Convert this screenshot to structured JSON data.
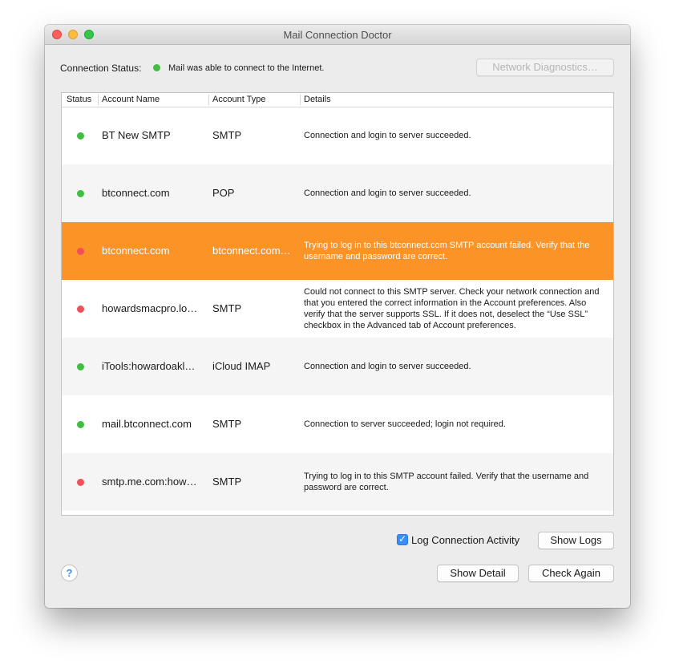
{
  "window": {
    "title": "Mail Connection Doctor"
  },
  "status": {
    "label": "Connection Status:",
    "message": "Mail was able to connect to the Internet.",
    "indicator": "green"
  },
  "buttons": {
    "network_diagnostics": "Network Diagnostics…",
    "show_logs": "Show Logs",
    "show_detail": "Show Detail",
    "check_again": "Check Again",
    "help": "?"
  },
  "log_activity": {
    "label": "Log Connection Activity",
    "checked": true
  },
  "table": {
    "columns": [
      "Status",
      "Account Name",
      "Account Type",
      "Details"
    ],
    "rows": [
      {
        "status": "green",
        "name": "BT New SMTP",
        "type": "SMTP",
        "details": "Connection and login to server succeeded."
      },
      {
        "status": "green",
        "name": "btconnect.com",
        "type": "POP",
        "details": "Connection and login to server succeeded."
      },
      {
        "status": "red",
        "name": "btconnect.com",
        "type": "btconnect.com…",
        "details": "Trying to log in to this btconnect.com SMTP account failed. Verify that the username and password are correct."
      },
      {
        "status": "red",
        "name": "howardsmacpro.lo…",
        "type": "SMTP",
        "details": "Could not connect to this SMTP server. Check your network connection and that you entered the correct information in the Account preferences. Also verify that the server supports SSL. If it does not, deselect the “Use SSL” checkbox in the Advanced tab of Account preferences."
      },
      {
        "status": "green",
        "name": "iTools:howardoakl…",
        "type": "iCloud IMAP",
        "details": "Connection and login to server succeeded."
      },
      {
        "status": "green",
        "name": "mail.btconnect.com",
        "type": "SMTP",
        "details": "Connection to server succeeded; login not required."
      },
      {
        "status": "red",
        "name": "smtp.me.com:how…",
        "type": "SMTP",
        "details": "Trying to log in to this SMTP account failed. Verify that the username and password are correct."
      }
    ],
    "selected_index": 2
  },
  "colors": {
    "selection": "#fb9327",
    "status_green": "#3fbe3f",
    "status_red": "#f0505a"
  }
}
